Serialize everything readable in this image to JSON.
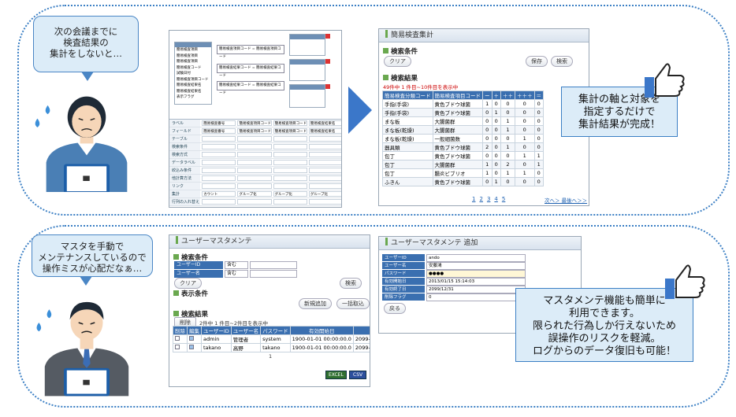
{
  "panel1": {
    "bubble_lines": [
      "次の会議までに",
      "検査結果の",
      "集計をしないと…"
    ],
    "editor": {
      "left_box_items": [
        "簡易検査項目",
        "簡易検査項目",
        "簡易検査項目",
        "簡易検査コード",
        "試験日付",
        "簡易検査項目コード",
        "簡易検査結果名",
        "簡易検査結果名",
        "表示フラグ"
      ],
      "mid_nodes": [
        "簡易検査項目コード = 簡易検査項目コード",
        "簡易検査結果コード = 簡易検査結果コード",
        "簡易検査結果コード = 簡易検査結果コード"
      ],
      "form_rows": [
        "ラベル",
        "フィールド",
        "テーブル",
        "検索条件",
        "検索方式",
        "データラベル",
        "絞込み条件",
        "他計算方法",
        "リンク",
        "集計",
        "行列の入れ替え"
      ],
      "form_cells": [
        "簡易検査番号",
        "簡易検査項目コード",
        "簡易検査項目コード",
        "簡易検査結果名"
      ],
      "agg_cells": [
        "カウント",
        "グループ化",
        "グループ化",
        "グループ化"
      ]
    },
    "result": {
      "title": "簡易検査集計",
      "cond_label": "検索条件",
      "clear_btn": "クリア",
      "save_btn": "保存",
      "search_btn": "検索",
      "results_label": "検索結果",
      "count_text": "49件中 1 件目~10件目を表示中",
      "headers": [
        "簡易検査分類コード",
        "簡易検査項目コード",
        "ー",
        "＋",
        "＋＋",
        "＋＋＋",
        "＝"
      ],
      "rows": [
        [
          "手指(手袋)",
          "黄色ブドウ球菌",
          "1",
          "0",
          "0",
          "0",
          "0"
        ],
        [
          "手指(手袋)",
          "黄色ブドウ球菌",
          "0",
          "1",
          "0",
          "0",
          "0"
        ],
        [
          "まな板",
          "大腸菌群",
          "0",
          "0",
          "1",
          "0",
          "0"
        ],
        [
          "まな板(乾燥)",
          "大腸菌群",
          "0",
          "0",
          "1",
          "0",
          "0"
        ],
        [
          "まな板(乾燥)",
          "一般細菌数",
          "0",
          "0",
          "0",
          "1",
          "0"
        ],
        [
          "器具類",
          "黄色ブドウ球菌",
          "2",
          "0",
          "1",
          "0",
          "0"
        ],
        [
          "包丁",
          "黄色ブドウ球菌",
          "0",
          "0",
          "0",
          "1",
          "1"
        ],
        [
          "包丁",
          "大腸菌群",
          "1",
          "0",
          "2",
          "0",
          "1"
        ],
        [
          "包丁",
          "腸炎ビブリオ",
          "1",
          "0",
          "1",
          "1",
          "0"
        ],
        [
          "ふきん",
          "黄色ブドウ球菌",
          "0",
          "1",
          "0",
          "0",
          "0"
        ]
      ],
      "pages": [
        "1",
        "2",
        "3",
        "4",
        "5"
      ],
      "next_link": "次へ＞ 最後へ＞＞"
    },
    "callout_lines": [
      "集計の軸と対象を",
      "指定するだけで",
      "集計結果が完成！"
    ]
  },
  "panel2": {
    "bubble_lines": [
      "マスタを手動で",
      "メンテナンスしているので",
      "操作ミスが心配だなぁ…"
    ],
    "master": {
      "title": "ユーザーマスタメンテ",
      "cond_label": "検索条件",
      "fields": [
        {
          "label": "ユーザーID",
          "op": "含む"
        },
        {
          "label": "ユーザー名",
          "op": "含む"
        }
      ],
      "clear_btn": "クリア",
      "search_btn": "検索",
      "display_label": "表示条件",
      "add_btn": "新規追加",
      "bulk_btn": "一括取込",
      "results_label": "検索結果",
      "delete_btn": "削除",
      "count_text": "2件中 1 件目~2件目を表示中",
      "headers": [
        "削除",
        "編集",
        "ユーザーID",
        "ユーザー名",
        "パスワード",
        "有効開始日",
        "有効終了日"
      ],
      "rows": [
        [
          "",
          "",
          "admin",
          "管理者",
          "system",
          "1900-01-01 00:00:00.0",
          "2099-01-01 00:00:00.0"
        ],
        [
          "",
          "",
          "takano",
          "高野",
          "takano",
          "1900-01-01 00:00:00.0",
          "2099-01-01 00:00:00.0"
        ]
      ],
      "page": "1",
      "excel_btn": "EXCEL",
      "csv_btn": "CSV"
    },
    "add": {
      "title": "ユーザーマスタメンテ 追加",
      "fields": [
        {
          "label": "ユーザーID",
          "value": "ando"
        },
        {
          "label": "ユーザー名",
          "value": "安藤鴻"
        },
        {
          "label": "パスワード",
          "value": "●●●●"
        },
        {
          "label": "有効開始日",
          "value": "2013/01/15 15:14:03"
        },
        {
          "label": "有効終了日",
          "value": "2099/12/31"
        },
        {
          "label": "削除フラグ",
          "value": "0"
        }
      ],
      "back_btn": "戻る"
    },
    "callout_lines": [
      "マスタメンテ機能も簡単に",
      "利用できます。",
      "限られた行為しか行えないため",
      "誤操作のリスクを軽減。",
      "ログからのデータ復旧も可能！"
    ]
  },
  "colors": {
    "accent": "#3b7fc4",
    "header": "#3a6fb0",
    "bubble": "#dcecf8"
  }
}
